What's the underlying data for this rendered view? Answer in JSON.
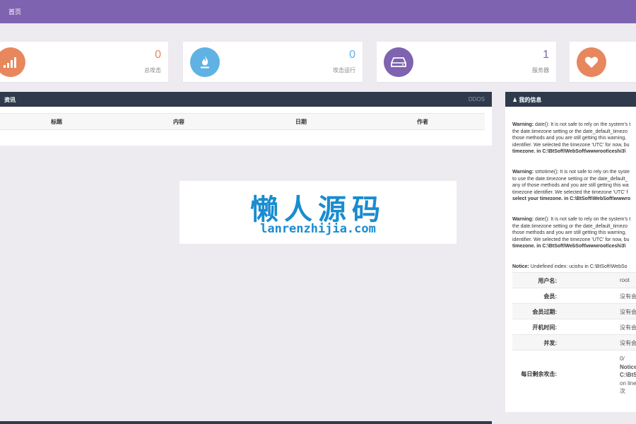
{
  "header": {
    "crumb": "首页"
  },
  "stats": [
    {
      "value": "0",
      "label": "总攻击",
      "color": "#e8875d",
      "icon": "signal-bars-icon"
    },
    {
      "value": "0",
      "label": "攻击运行",
      "color": "#5fb2e3",
      "icon": "fire-icon"
    },
    {
      "value": "1",
      "label": "服务器",
      "color": "#7e63b1",
      "icon": "server-icon"
    },
    {
      "value": "",
      "label": "",
      "color": "#e8875d",
      "icon": "heart-icon"
    }
  ],
  "news": {
    "title": "资讯",
    "tag": "DDOS",
    "columns": [
      "标题",
      "内容",
      "日期",
      "作者"
    ]
  },
  "info": {
    "title": "我的信息",
    "warnings": [
      {
        "prefix": "Warning:",
        "lines": [
          " date(): It is not safe to rely on the system's t",
          "the date.timezone setting or the date_default_timezo",
          "those methods and you are still getting this warning,",
          "identifier. We selected the timezone 'UTC' for now, bu",
          "timezone. in C:\\BtSoft\\WebSoft\\wwwroot\\ceshi3\\"
        ]
      },
      {
        "prefix": "Warning:",
        "lines": [
          " strtotime(): It is not safe to rely on the syste",
          "to use the date.timezone setting or the date_default_",
          "any of those methods and you are still getting this wa",
          "timezone identifier. We selected the timezone 'UTC' f",
          "select your timezone. in C:\\BtSoft\\WebSoft\\wwwro"
        ]
      },
      {
        "prefix": "Warning:",
        "lines": [
          " date(): It is not safe to rely on the system's t",
          "the date.timezone setting or the date_default_timezo",
          "those methods and you are still getting this warning,",
          "identifier. We selected the timezone 'UTC' for now, bu",
          "timezone. in C:\\BtSoft\\WebSoft\\wwwroot\\ceshi3\\"
        ]
      },
      {
        "prefix": "Notice:",
        "lines": [
          " Undefined index: ucishu in C:\\BtSoft\\WebSo"
        ]
      }
    ],
    "rows": [
      {
        "key": "用户名:",
        "value": "root"
      },
      {
        "key": "会员:",
        "value": "没有会"
      },
      {
        "key": "会员过期:",
        "value": "没有会"
      },
      {
        "key": "开机时间:",
        "value": "没有会"
      },
      {
        "key": "并发:",
        "value": "没有会"
      },
      {
        "key": "每日剩余攻击:",
        "value_lines": [
          "0/",
          "Notice",
          "C:\\BtS",
          "on line",
          "次"
        ]
      }
    ]
  },
  "watermark": {
    "big": "懒人源码",
    "small": "lanrenzhijia.com"
  }
}
